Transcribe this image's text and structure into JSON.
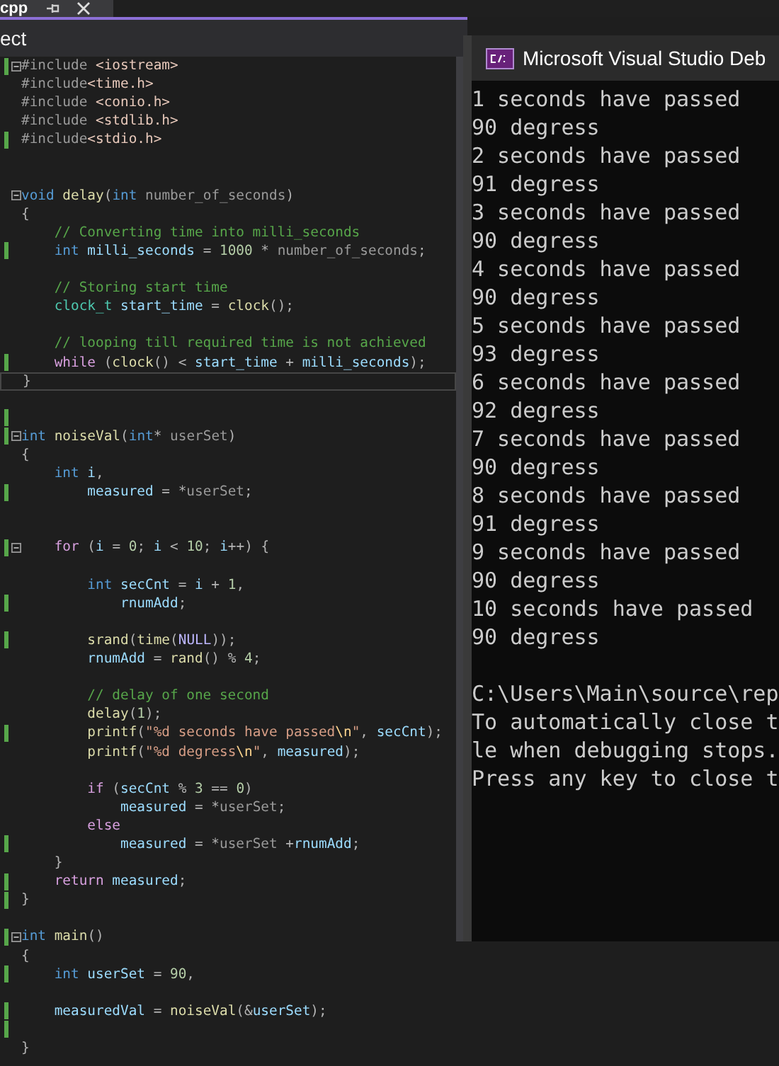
{
  "tab": {
    "label": "cpp"
  },
  "navigation_bar": {
    "label": "ect"
  },
  "editor": {
    "lines": [
      {
        "changed": true,
        "fold": true,
        "current": false,
        "tokens": [
          {
            "kind": "pre",
            "text": "#include "
          },
          {
            "kind": "inc",
            "text": "<iostream>"
          }
        ]
      },
      {
        "changed": false,
        "fold": false,
        "current": false,
        "tokens": [
          {
            "kind": "pre",
            "text": "#include"
          },
          {
            "kind": "inc",
            "text": "<time.h>"
          }
        ]
      },
      {
        "changed": false,
        "fold": false,
        "current": false,
        "tokens": [
          {
            "kind": "pre",
            "text": "#include "
          },
          {
            "kind": "inc",
            "text": "<conio.h>"
          }
        ]
      },
      {
        "changed": false,
        "fold": false,
        "current": false,
        "tokens": [
          {
            "kind": "pre",
            "text": "#include "
          },
          {
            "kind": "inc",
            "text": "<stdlib.h>"
          }
        ]
      },
      {
        "changed": true,
        "fold": false,
        "current": false,
        "tokens": [
          {
            "kind": "pre",
            "text": "#include"
          },
          {
            "kind": "inc",
            "text": "<stdio.h>"
          }
        ]
      },
      {
        "changed": false,
        "fold": false,
        "current": false
      },
      {
        "changed": false,
        "fold": false,
        "current": false
      },
      {
        "changed": false,
        "fold": true,
        "current": false,
        "tokens": [
          {
            "kind": "kw",
            "text": "void "
          },
          {
            "kind": "fn",
            "text": "delay"
          },
          {
            "kind": "punct",
            "text": "("
          },
          {
            "kind": "kw",
            "text": "int "
          },
          {
            "kind": "param",
            "text": "number_of_seconds"
          },
          {
            "kind": "punct",
            "text": ")"
          }
        ]
      },
      {
        "changed": false,
        "fold": false,
        "current": false,
        "tokens": [
          {
            "kind": "punct",
            "text": "{"
          }
        ]
      },
      {
        "changed": false,
        "fold": false,
        "current": false,
        "tokens": [
          {
            "kind": "cmt",
            "text": "    // Converting time into milli_seconds"
          }
        ]
      },
      {
        "changed": true,
        "fold": false,
        "current": false,
        "tokens": [
          {
            "kind": "kw",
            "text": "    int "
          },
          {
            "kind": "var",
            "text": "milli_seconds"
          },
          {
            "kind": "punct",
            "text": " = "
          },
          {
            "kind": "num",
            "text": "1000"
          },
          {
            "kind": "punct",
            "text": " * "
          },
          {
            "kind": "param",
            "text": "number_of_seconds"
          },
          {
            "kind": "punct",
            "text": ";"
          }
        ]
      },
      {
        "changed": false,
        "fold": false,
        "current": false
      },
      {
        "changed": false,
        "fold": false,
        "current": false,
        "tokens": [
          {
            "kind": "cmt",
            "text": "    // Storing start time"
          }
        ]
      },
      {
        "changed": false,
        "fold": false,
        "current": false,
        "tokens": [
          {
            "kind": "type",
            "text": "    clock_t "
          },
          {
            "kind": "var",
            "text": "start_time"
          },
          {
            "kind": "punct",
            "text": " = "
          },
          {
            "kind": "fn",
            "text": "clock"
          },
          {
            "kind": "punct",
            "text": "();"
          }
        ]
      },
      {
        "changed": false,
        "fold": false,
        "current": false
      },
      {
        "changed": false,
        "fold": false,
        "current": false,
        "tokens": [
          {
            "kind": "cmt",
            "text": "    // looping till required time is not achieved"
          }
        ]
      },
      {
        "changed": true,
        "fold": false,
        "current": false,
        "tokens": [
          {
            "kind": "ctl",
            "text": "    while "
          },
          {
            "kind": "punct",
            "text": "("
          },
          {
            "kind": "fn",
            "text": "clock"
          },
          {
            "kind": "punct",
            "text": "() < "
          },
          {
            "kind": "var",
            "text": "start_time"
          },
          {
            "kind": "punct",
            "text": " + "
          },
          {
            "kind": "var",
            "text": "milli_seconds"
          },
          {
            "kind": "punct",
            "text": ");"
          }
        ]
      },
      {
        "changed": false,
        "fold": false,
        "current": true,
        "tokens": [
          {
            "kind": "punct",
            "text": "}"
          }
        ]
      },
      {
        "changed": false,
        "fold": false,
        "current": false
      },
      {
        "changed": true,
        "fold": false,
        "current": false
      },
      {
        "changed": true,
        "fold": true,
        "current": false,
        "tokens": [
          {
            "kind": "kw",
            "text": "int "
          },
          {
            "kind": "fn",
            "text": "noiseVal"
          },
          {
            "kind": "punct",
            "text": "("
          },
          {
            "kind": "kw",
            "text": "int"
          },
          {
            "kind": "punct",
            "text": "* "
          },
          {
            "kind": "param",
            "text": "userSet"
          },
          {
            "kind": "punct",
            "text": ")"
          }
        ]
      },
      {
        "changed": false,
        "fold": false,
        "current": false,
        "tokens": [
          {
            "kind": "punct",
            "text": "{"
          }
        ]
      },
      {
        "changed": false,
        "fold": false,
        "current": false,
        "tokens": [
          {
            "kind": "kw",
            "text": "    int "
          },
          {
            "kind": "var",
            "text": "i"
          },
          {
            "kind": "punct",
            "text": ","
          }
        ]
      },
      {
        "changed": true,
        "fold": false,
        "current": false,
        "tokens": [
          {
            "kind": "var",
            "text": "        measured"
          },
          {
            "kind": "punct",
            "text": " = *"
          },
          {
            "kind": "param",
            "text": "userSet"
          },
          {
            "kind": "punct",
            "text": ";"
          }
        ]
      },
      {
        "changed": false,
        "fold": false,
        "current": false
      },
      {
        "changed": false,
        "fold": false,
        "current": false
      },
      {
        "changed": true,
        "fold": true,
        "current": false,
        "tokens": [
          {
            "kind": "ctl",
            "text": "    for "
          },
          {
            "kind": "punct",
            "text": "("
          },
          {
            "kind": "var",
            "text": "i"
          },
          {
            "kind": "punct",
            "text": " = "
          },
          {
            "kind": "num",
            "text": "0"
          },
          {
            "kind": "punct",
            "text": "; "
          },
          {
            "kind": "var",
            "text": "i"
          },
          {
            "kind": "punct",
            "text": " < "
          },
          {
            "kind": "num",
            "text": "10"
          },
          {
            "kind": "punct",
            "text": "; "
          },
          {
            "kind": "var",
            "text": "i"
          },
          {
            "kind": "punct",
            "text": "++) {"
          }
        ]
      },
      {
        "changed": false,
        "fold": false,
        "current": false
      },
      {
        "changed": false,
        "fold": false,
        "current": false,
        "tokens": [
          {
            "kind": "kw",
            "text": "        int "
          },
          {
            "kind": "var",
            "text": "secCnt"
          },
          {
            "kind": "punct",
            "text": " = "
          },
          {
            "kind": "var",
            "text": "i"
          },
          {
            "kind": "punct",
            "text": " + "
          },
          {
            "kind": "num",
            "text": "1"
          },
          {
            "kind": "punct",
            "text": ","
          }
        ]
      },
      {
        "changed": true,
        "fold": false,
        "current": false,
        "tokens": [
          {
            "kind": "var",
            "text": "            rnumAdd"
          },
          {
            "kind": "punct",
            "text": ";"
          }
        ]
      },
      {
        "changed": false,
        "fold": false,
        "current": false
      },
      {
        "changed": true,
        "fold": false,
        "current": false,
        "tokens": [
          {
            "kind": "fn",
            "text": "        srand"
          },
          {
            "kind": "punct",
            "text": "("
          },
          {
            "kind": "fn",
            "text": "time"
          },
          {
            "kind": "punct",
            "text": "("
          },
          {
            "kind": "macro",
            "text": "NULL"
          },
          {
            "kind": "punct",
            "text": "));"
          }
        ]
      },
      {
        "changed": false,
        "fold": false,
        "current": false,
        "tokens": [
          {
            "kind": "var",
            "text": "        rnumAdd"
          },
          {
            "kind": "punct",
            "text": " = "
          },
          {
            "kind": "fn",
            "text": "rand"
          },
          {
            "kind": "punct",
            "text": "() % "
          },
          {
            "kind": "num",
            "text": "4"
          },
          {
            "kind": "punct",
            "text": ";"
          }
        ]
      },
      {
        "changed": false,
        "fold": false,
        "current": false
      },
      {
        "changed": false,
        "fold": false,
        "current": false,
        "tokens": [
          {
            "kind": "cmt",
            "text": "        // delay of one second"
          }
        ]
      },
      {
        "changed": false,
        "fold": false,
        "current": false,
        "tokens": [
          {
            "kind": "fn",
            "text": "        delay"
          },
          {
            "kind": "punct",
            "text": "("
          },
          {
            "kind": "num",
            "text": "1"
          },
          {
            "kind": "punct",
            "text": ");"
          }
        ]
      },
      {
        "changed": true,
        "fold": false,
        "current": false,
        "tokens": [
          {
            "kind": "fn",
            "text": "        printf"
          },
          {
            "kind": "punct",
            "text": "("
          },
          {
            "kind": "str",
            "text": "\"%d seconds have passed"
          },
          {
            "kind": "esc",
            "text": "\\n"
          },
          {
            "kind": "str",
            "text": "\""
          },
          {
            "kind": "punct",
            "text": ", "
          },
          {
            "kind": "var",
            "text": "secCnt"
          },
          {
            "kind": "punct",
            "text": ");"
          }
        ]
      },
      {
        "changed": false,
        "fold": false,
        "current": false,
        "tokens": [
          {
            "kind": "fn",
            "text": "        printf"
          },
          {
            "kind": "punct",
            "text": "("
          },
          {
            "kind": "str",
            "text": "\"%d degress"
          },
          {
            "kind": "esc",
            "text": "\\n"
          },
          {
            "kind": "str",
            "text": "\""
          },
          {
            "kind": "punct",
            "text": ", "
          },
          {
            "kind": "var",
            "text": "measured"
          },
          {
            "kind": "punct",
            "text": ");"
          }
        ]
      },
      {
        "changed": false,
        "fold": false,
        "current": false
      },
      {
        "changed": false,
        "fold": false,
        "current": false,
        "tokens": [
          {
            "kind": "ctl",
            "text": "        if "
          },
          {
            "kind": "punct",
            "text": "("
          },
          {
            "kind": "var",
            "text": "secCnt"
          },
          {
            "kind": "punct",
            "text": " % "
          },
          {
            "kind": "num",
            "text": "3"
          },
          {
            "kind": "punct",
            "text": " == "
          },
          {
            "kind": "num",
            "text": "0"
          },
          {
            "kind": "punct",
            "text": ")"
          }
        ]
      },
      {
        "changed": false,
        "fold": false,
        "current": false,
        "tokens": [
          {
            "kind": "var",
            "text": "            measured"
          },
          {
            "kind": "punct",
            "text": " = *"
          },
          {
            "kind": "param",
            "text": "userSet"
          },
          {
            "kind": "punct",
            "text": ";"
          }
        ]
      },
      {
        "changed": false,
        "fold": false,
        "current": false,
        "tokens": [
          {
            "kind": "ctl",
            "text": "        else"
          }
        ]
      },
      {
        "changed": true,
        "fold": false,
        "current": false,
        "tokens": [
          {
            "kind": "var",
            "text": "            measured"
          },
          {
            "kind": "punct",
            "text": " = *"
          },
          {
            "kind": "param",
            "text": "userSet"
          },
          {
            "kind": "punct",
            "text": " +"
          },
          {
            "kind": "var",
            "text": "rnumAdd"
          },
          {
            "kind": "punct",
            "text": ";"
          }
        ]
      },
      {
        "changed": false,
        "fold": false,
        "current": false,
        "tokens": [
          {
            "kind": "punct",
            "text": "    }"
          }
        ]
      },
      {
        "changed": true,
        "fold": false,
        "current": false,
        "tokens": [
          {
            "kind": "ctl",
            "text": "    return "
          },
          {
            "kind": "var",
            "text": "measured"
          },
          {
            "kind": "punct",
            "text": ";"
          }
        ]
      },
      {
        "changed": true,
        "fold": false,
        "current": false,
        "tokens": [
          {
            "kind": "punct",
            "text": "}"
          }
        ]
      },
      {
        "changed": false,
        "fold": false,
        "current": false
      },
      {
        "changed": true,
        "fold": true,
        "current": false,
        "tokens": [
          {
            "kind": "kw",
            "text": "int "
          },
          {
            "kind": "fn",
            "text": "main"
          },
          {
            "kind": "punct",
            "text": "()"
          }
        ]
      },
      {
        "changed": false,
        "fold": false,
        "current": false,
        "tokens": [
          {
            "kind": "punct",
            "text": "{"
          }
        ]
      },
      {
        "changed": true,
        "fold": false,
        "current": false,
        "tokens": [
          {
            "kind": "kw",
            "text": "    int "
          },
          {
            "kind": "var",
            "text": "userSet"
          },
          {
            "kind": "punct",
            "text": " = "
          },
          {
            "kind": "num",
            "text": "90"
          },
          {
            "kind": "punct",
            "text": ","
          }
        ]
      },
      {
        "changed": false,
        "fold": false,
        "current": false
      },
      {
        "changed": true,
        "fold": false,
        "current": false,
        "tokens": [
          {
            "kind": "var",
            "text": "    measuredVal"
          },
          {
            "kind": "punct",
            "text": " = "
          },
          {
            "kind": "fn",
            "text": "noiseVal"
          },
          {
            "kind": "punct",
            "text": "(&"
          },
          {
            "kind": "var",
            "text": "userSet"
          },
          {
            "kind": "punct",
            "text": ");"
          }
        ]
      },
      {
        "changed": true,
        "fold": false,
        "current": false
      },
      {
        "changed": false,
        "fold": false,
        "current": false,
        "tokens": [
          {
            "kind": "punct",
            "text": "}"
          }
        ]
      }
    ]
  },
  "console": {
    "title": "Microsoft Visual Studio Deb",
    "output": [
      "1 seconds have passed",
      "90 degress",
      "2 seconds have passed",
      "91 degress",
      "3 seconds have passed",
      "90 degress",
      "4 seconds have passed",
      "90 degress",
      "5 seconds have passed",
      "93 degress",
      "6 seconds have passed",
      "92 degress",
      "7 seconds have passed",
      "90 degress",
      "8 seconds have passed",
      "91 degress",
      "9 seconds have passed",
      "90 degress",
      "10 seconds have passed",
      "90 degress"
    ],
    "footer": [
      "C:\\Users\\Main\\source\\rep",
      "To automatically close t",
      "le when debugging stops.",
      "Press any key to close t"
    ]
  }
}
